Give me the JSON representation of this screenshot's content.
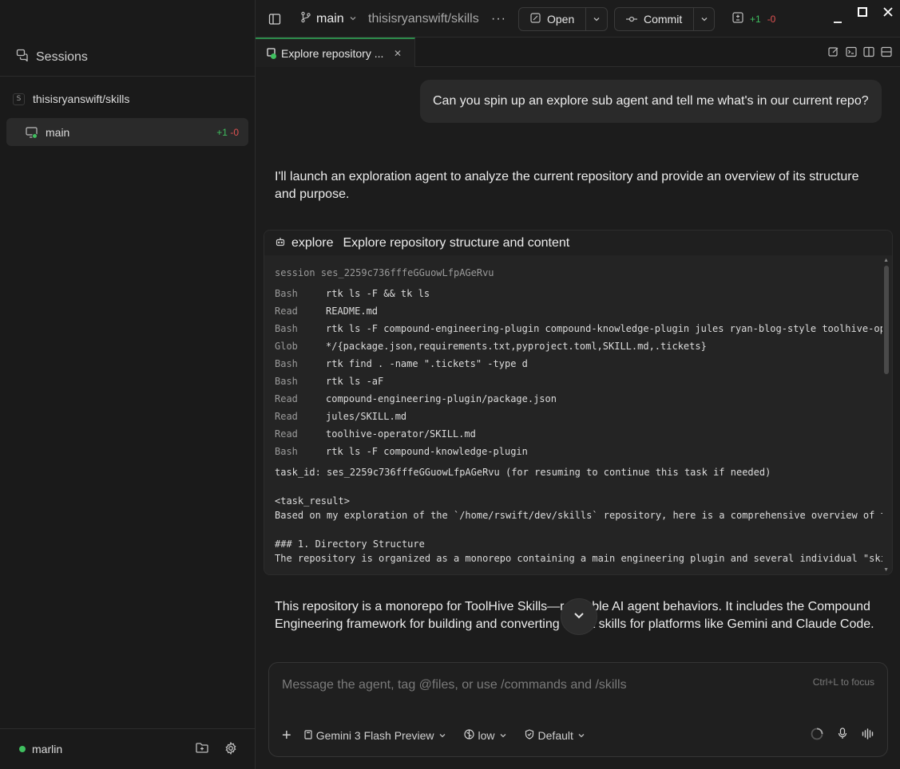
{
  "sidebar": {
    "title": "Sessions",
    "repo": {
      "badge": "S",
      "name": "thisisryanswift/skills"
    },
    "branch": {
      "name": "main",
      "added": "+1",
      "removed": "-0"
    },
    "footer": {
      "user": "marlin"
    }
  },
  "topbar": {
    "branch": "main",
    "repo": "thisisryanswift/skills",
    "open_label": "Open",
    "commit_label": "Commit",
    "diff_added": "+1",
    "diff_removed": "-0"
  },
  "tab": {
    "label": "Explore repository ..."
  },
  "chat": {
    "user_message": "Can you spin up an explore sub agent and tell me what's in our current repo?",
    "assistant_intro": "I'll launch an exploration agent to analyze the current repository and provide an overview of its structure and purpose.",
    "tool": {
      "name": "explore",
      "description": "Explore repository structure and content",
      "session": "session ses_2259c736fffeGGuowLfpAGeRvu",
      "calls": [
        {
          "tool": "Bash",
          "arg": "rtk ls -F && tk ls"
        },
        {
          "tool": "Read",
          "arg": "README.md"
        },
        {
          "tool": "Bash",
          "arg": "rtk ls -F compound-engineering-plugin compound-knowledge-plugin jules ryan-blog-style toolhive-op"
        },
        {
          "tool": "Glob",
          "arg": "*/{package.json,requirements.txt,pyproject.toml,SKILL.md,.tickets}"
        },
        {
          "tool": "Bash",
          "arg": "rtk find . -name \".tickets\" -type d"
        },
        {
          "tool": "Bash",
          "arg": "rtk ls -aF"
        },
        {
          "tool": "Read",
          "arg": "compound-engineering-plugin/package.json"
        },
        {
          "tool": "Read",
          "arg": "jules/SKILL.md"
        },
        {
          "tool": "Read",
          "arg": "toolhive-operator/SKILL.md"
        },
        {
          "tool": "Bash",
          "arg": "rtk ls -F compound-knowledge-plugin"
        }
      ],
      "task_id_line": "task_id: ses_2259c736fffeGGuowLfpAGeRvu (for resuming to continue this task if needed)",
      "result_open": "<task_result>",
      "result_line1": "Based on my exploration of the `/home/rswift/dev/skills` repository, here is a comprehensive overview of t",
      "heading": "### 1. Directory Structure",
      "result_line2": "The repository is organized as a monorepo containing a main engineering plugin and several individual \"ski"
    },
    "summary": "This repository is a monorepo for ToolHive Skills—reusable AI agent behaviors. It includes the Compound Engineering framework for building and converting agent skills for platforms like Gemini and Claude Code."
  },
  "composer": {
    "placeholder": "Message the agent, tag @files, or use /commands and /skills",
    "hint": "Ctrl+L to focus",
    "model": "Gemini 3 Flash Preview",
    "effort": "low",
    "mode": "Default"
  },
  "colors": {
    "accent_green": "#3fbf5f",
    "removed_red": "#e05252",
    "background": "#1c1c1c"
  }
}
